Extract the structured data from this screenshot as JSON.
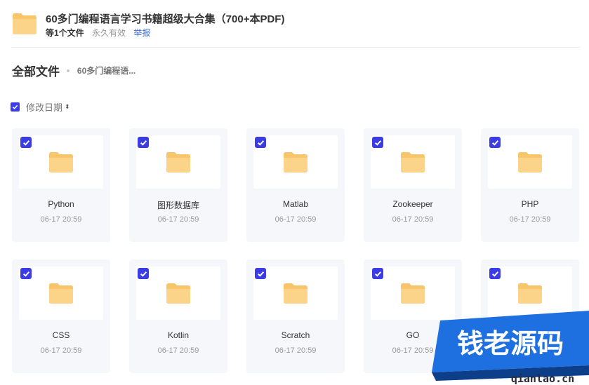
{
  "share": {
    "title": "60多门编程语言学习书籍超级大合集（700+本PDF)",
    "count": "等1个文件",
    "validity": "永久有效",
    "report_label": "举报"
  },
  "breadcrumb": {
    "root": "全部文件",
    "current": "60多门编程语..."
  },
  "sort": {
    "label": "修改日期",
    "arrow": "⬍"
  },
  "files": [
    {
      "name": "Python",
      "date": "06-17 20:59"
    },
    {
      "name": "图形数据库",
      "date": "06-17 20:59"
    },
    {
      "name": "Matlab",
      "date": "06-17 20:59"
    },
    {
      "name": "Zookeeper",
      "date": "06-17 20:59"
    },
    {
      "name": "PHP",
      "date": "06-17 20:59"
    },
    {
      "name": "CSS",
      "date": "06-17 20:59"
    },
    {
      "name": "Kotlin",
      "date": "06-17 20:59"
    },
    {
      "name": "Scratch",
      "date": "06-17 20:59"
    },
    {
      "name": "GO",
      "date": "06-17 20:59"
    },
    {
      "name": "",
      "date": ""
    }
  ],
  "watermark": {
    "brand": "钱老源码",
    "domain": "qianlao.cn"
  },
  "colors": {
    "accent": "#3c3ce6",
    "folder": "#f8c56b",
    "card_bg": "#f6f7fb",
    "link": "#3c6ce0",
    "watermark_blue": "#1e6fe0"
  }
}
